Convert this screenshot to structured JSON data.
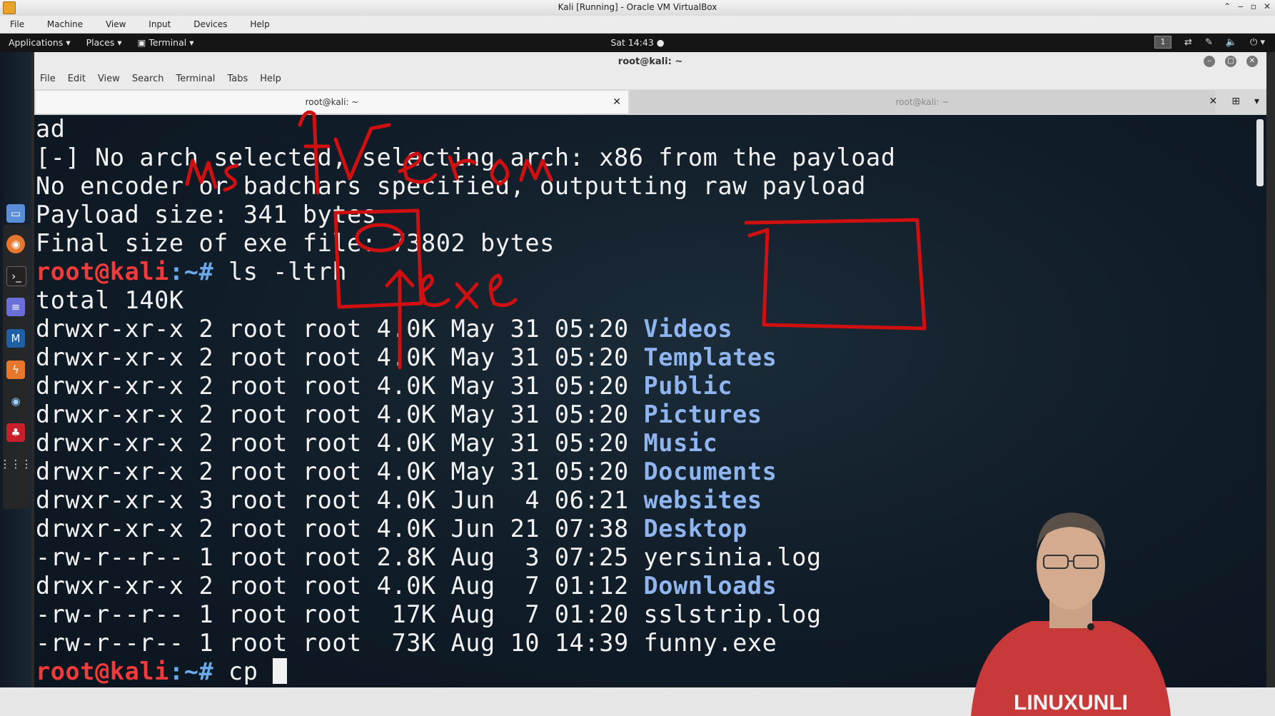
{
  "vbox": {
    "title": "Kali [Running] - Oracle VM VirtualBox",
    "menu": [
      "File",
      "Machine",
      "View",
      "Input",
      "Devices",
      "Help"
    ]
  },
  "gnome": {
    "applications": "Applications ▾",
    "places": "Places ▾",
    "terminal": "Terminal ▾",
    "clock": "Sat 14:43 ●",
    "workspace": "1"
  },
  "terminal": {
    "window_title": "root@kali: ~",
    "menu": [
      "File",
      "Edit",
      "View",
      "Search",
      "Terminal",
      "Tabs",
      "Help"
    ],
    "tabs": [
      {
        "label": "root@kali: ~",
        "active": true
      },
      {
        "label": "root@kali: ~",
        "active": false
      }
    ],
    "output": {
      "l1": "ad",
      "l2": "[-] No arch selected, selecting arch: x86 from the payload",
      "l3": "No encoder or badchars specified, outputting raw payload",
      "l4": "Payload size: 341 bytes",
      "l5": "Final size of exe file: 73802 bytes",
      "prompt_user": "root@kali",
      "prompt_path": ":~#",
      "cmd1": " ls -ltrh",
      "total": "total 140K",
      "cmd2": " cp "
    },
    "listing": [
      {
        "meta": "drwxr-xr-x 2 root root 4.0K May 31 05:20 ",
        "name": "Videos",
        "dir": true
      },
      {
        "meta": "drwxr-xr-x 2 root root 4.0K May 31 05:20 ",
        "name": "Templates",
        "dir": true
      },
      {
        "meta": "drwxr-xr-x 2 root root 4.0K May 31 05:20 ",
        "name": "Public",
        "dir": true
      },
      {
        "meta": "drwxr-xr-x 2 root root 4.0K May 31 05:20 ",
        "name": "Pictures",
        "dir": true
      },
      {
        "meta": "drwxr-xr-x 2 root root 4.0K May 31 05:20 ",
        "name": "Music",
        "dir": true
      },
      {
        "meta": "drwxr-xr-x 2 root root 4.0K May 31 05:20 ",
        "name": "Documents",
        "dir": true
      },
      {
        "meta": "drwxr-xr-x 3 root root 4.0K Jun  4 06:21 ",
        "name": "websites",
        "dir": true
      },
      {
        "meta": "drwxr-xr-x 2 root root 4.0K Jun 21 07:38 ",
        "name": "Desktop",
        "dir": true
      },
      {
        "meta": "-rw-r--r-- 1 root root 2.8K Aug  3 07:25 ",
        "name": "yersinia.log",
        "dir": false
      },
      {
        "meta": "drwxr-xr-x 2 root root 4.0K Aug  7 01:12 ",
        "name": "Downloads",
        "dir": true
      },
      {
        "meta": "-rw-r--r-- 1 root root  17K Aug  7 01:20 ",
        "name": "sslstrip.log",
        "dir": false
      },
      {
        "meta": "-rw-r--r-- 1 root root  73K Aug 10 14:39 ",
        "name": "funny.exe",
        "dir": false
      }
    ]
  },
  "annotations": {
    "handwritten_1": "msfVenom",
    "handwritten_2": ".exe"
  },
  "presenter": {
    "shirt_text": "LINUXUNLI"
  },
  "colors": {
    "prompt_user": "#f23a3a",
    "prompt_path": "#6aa8e8",
    "directory": "#8fb5f0",
    "annotation_red": "#d01010",
    "terminal_bg": "#101c27"
  },
  "dock_icons": [
    "files-icon",
    "firefox-icon",
    "terminal-icon",
    "text-editor-icon",
    "metasploit-icon",
    "burpsuite-icon",
    "eye-icon",
    "cherrytree-icon",
    "show-apps-icon"
  ]
}
